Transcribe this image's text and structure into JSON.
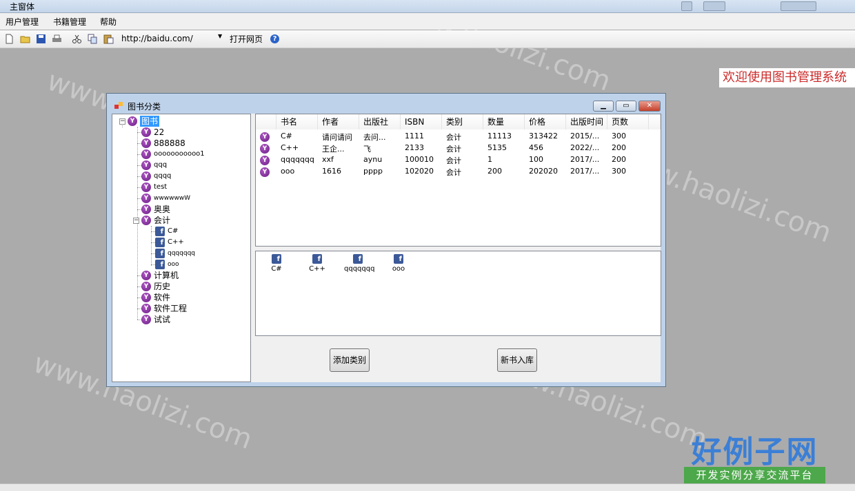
{
  "window": {
    "title": "主窗体"
  },
  "menu": {
    "items": [
      "用户管理",
      "书籍管理",
      "帮助"
    ]
  },
  "toolbar": {
    "url_value": "http://baidu.com/",
    "open_page_label": "打开网页",
    "help_label": "?"
  },
  "welcome_text": "欢迎使用图书管理系统",
  "child_window": {
    "title": "图书分类",
    "tree": {
      "root": "图书",
      "categories": [
        "22",
        "888888",
        "ooooooooooo1",
        "qqq",
        "qqqq",
        "test",
        "wwwwwwW",
        "奥奥",
        "会计",
        "计算机",
        "历史",
        "软件",
        "软件工程",
        "试试"
      ],
      "expanded_category": "会计",
      "expanded_children": [
        "C#",
        "C++",
        "qqqqqqq",
        "ooo"
      ]
    },
    "list": {
      "columns": [
        "书名",
        "作者",
        "出版社",
        "ISBN",
        "类别",
        "数量",
        "价格",
        "出版时间",
        "页数"
      ],
      "rows": [
        [
          "C#",
          "请问请问",
          "去问...",
          "1111",
          "会计",
          "11113",
          "313422",
          "2015/...",
          "300"
        ],
        [
          "C++",
          "王企...",
          "飞",
          "2133",
          "会计",
          "5135",
          "456",
          "2022/...",
          "200"
        ],
        [
          "qqqqqqq",
          "xxf",
          "aynu",
          "100010",
          "会计",
          "1",
          "100",
          "2017/...",
          "200"
        ],
        [
          "ooo",
          "1616",
          "pppp",
          "102020",
          "会计",
          "200",
          "202020",
          "2017/...",
          "300"
        ]
      ]
    },
    "icons": [
      "C#",
      "C++",
      "qqqqqqq",
      "ooo"
    ],
    "buttons": {
      "add_category": "添加类别",
      "new_book": "新书入库"
    }
  },
  "logo": {
    "main": "好例子网",
    "sub": "开发实例分享交流平台"
  },
  "colors": {
    "welcome_text": "#cc2b2b",
    "desktop": "#ababab",
    "tree_icon": "#7b2a96",
    "book_icon": "#3b5998"
  }
}
